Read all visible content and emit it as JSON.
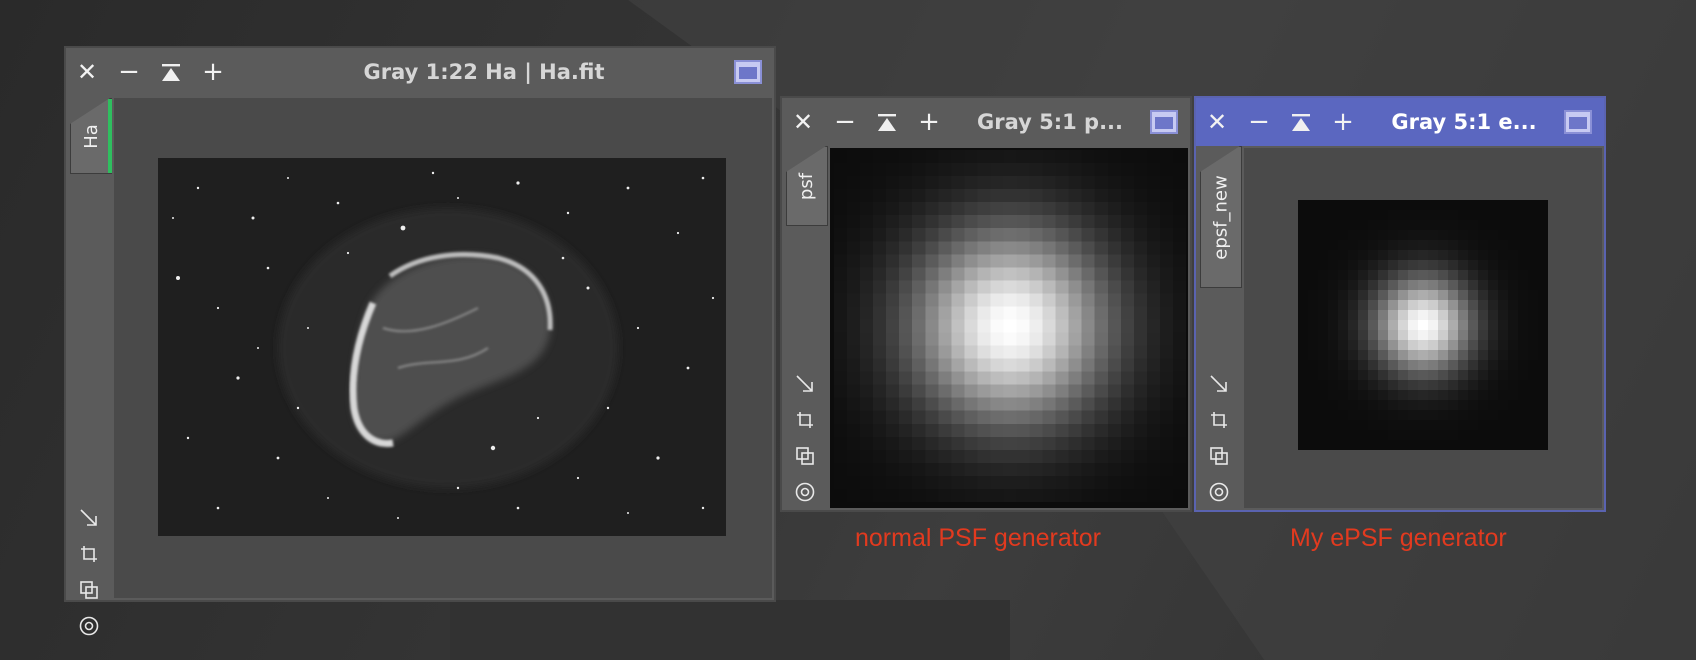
{
  "windows": [
    {
      "id": "ha",
      "title": "Gray 1:22 Ha | Ha.fit",
      "tab_label": "Ha",
      "active": false
    },
    {
      "id": "psf",
      "title": "Gray 5:1 p...",
      "tab_label": "psf",
      "active": false
    },
    {
      "id": "epsf",
      "title": "Gray 5:1 e...",
      "tab_label": "epsf_new",
      "active": true
    }
  ],
  "controls": {
    "close": "✕",
    "minimize": "−",
    "shade": "shade",
    "zoom_in": "+"
  },
  "captions": {
    "psf": "normal PSF generator",
    "epsf": "My ePSF generator"
  },
  "icons": [
    "close-icon",
    "minimize-icon",
    "shade-icon",
    "zoom-in-icon",
    "maximize-icon",
    "fit-view-icon",
    "crop-icon",
    "clone-icon",
    "target-icon"
  ],
  "colors": {
    "active_titlebar": "#5b67c0",
    "caption": "#e23a1f",
    "tab_marker": "#2fbf5f",
    "window": "#5b5b5b"
  }
}
